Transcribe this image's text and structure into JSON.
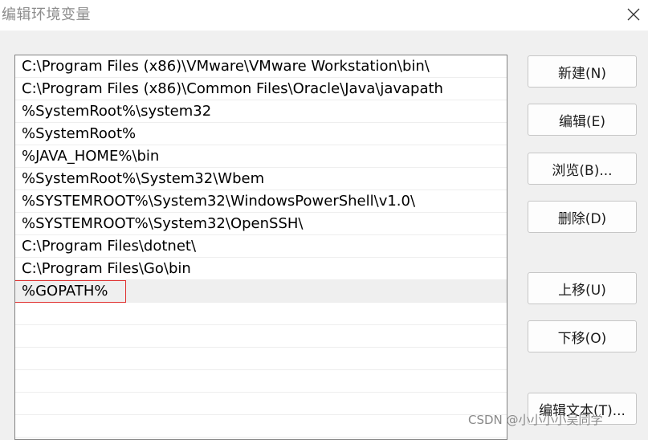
{
  "window": {
    "title": "编辑环境变量"
  },
  "list": {
    "items": [
      "C:\\Program Files (x86)\\VMware\\VMware Workstation\\bin\\",
      "C:\\Program Files (x86)\\Common Files\\Oracle\\Java\\javapath",
      "%SystemRoot%\\system32",
      "%SystemRoot%",
      "%JAVA_HOME%\\bin",
      "%SystemRoot%\\System32\\Wbem",
      "%SYSTEMROOT%\\System32\\WindowsPowerShell\\v1.0\\",
      "%SYSTEMROOT%\\System32\\OpenSSH\\",
      "C:\\Program Files\\dotnet\\",
      "C:\\Program Files\\Go\\bin",
      "%GOPATH%",
      "",
      "",
      "",
      "",
      "",
      ""
    ],
    "selected_index": 10
  },
  "buttons": {
    "new": "新建(N)",
    "edit": "编辑(E)",
    "browse": "浏览(B)...",
    "delete": "删除(D)",
    "move_up": "上移(U)",
    "move_down": "下移(O)",
    "edit_text": "编辑文本(T)..."
  },
  "watermark": "CSDN @小小小小吴同学"
}
